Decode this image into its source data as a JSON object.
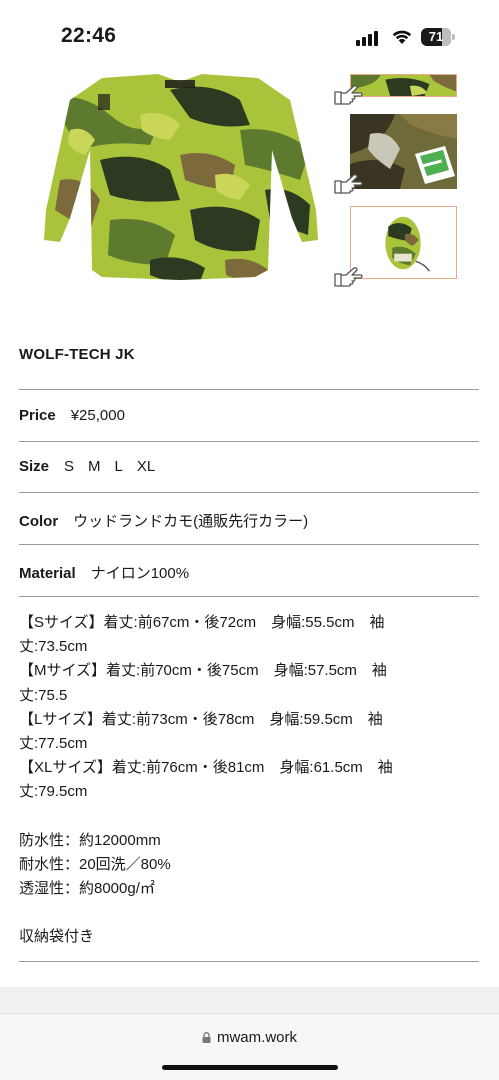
{
  "status_bar": {
    "time": "22:46",
    "battery_level": "71",
    "battery_fraction": 0.71
  },
  "gallery": {
    "main_image": "camo-jacket-photo",
    "thumbnails": [
      "camo-fabric-closeup-thumbnail",
      "camo-tag-detail-thumbnail",
      "camo-stuff-bag-thumbnail"
    ],
    "pointer_icon": "pointing-hand-icon",
    "camo_colors": [
      "#a9c43a",
      "#5d7a2e",
      "#2c3a22",
      "#7d6a3c",
      "#c9d65a"
    ],
    "thumb_border_color": "#e8a98c"
  },
  "product": {
    "name": "WOLF-TECH JK",
    "price_label": "Price",
    "price_value": "¥25,000",
    "size_label": "Size",
    "sizes": [
      "S",
      "M",
      "L",
      "XL"
    ],
    "color_label": "Color",
    "color_value": "ウッドランドカモ(通販先行カラー)",
    "material_label": "Material",
    "material_value": "ナイロン100%"
  },
  "description": {
    "size_lines": [
      "【Sサイズ】着丈:前67cm・後72cm　身幅:55.5cm　袖",
      "丈:73.5cm",
      "【Mサイズ】着丈:前70cm・後75cm　身幅:57.5cm　袖",
      "丈:75.5",
      "【Lサイズ】着丈:前73cm・後78cm　身幅:59.5cm　袖",
      "丈:77.5cm",
      "【XLサイズ】着丈:前76cm・後81cm　身幅:61.5cm　袖",
      "丈:79.5cm"
    ],
    "performance_lines": [
      "防水性：約12000mm",
      "耐水性：20回洗／80%",
      "透湿性：約8000g/㎡"
    ],
    "accessory": "収納袋付き"
  },
  "browser": {
    "url": "mwam.work",
    "lock_icon": "lock-icon"
  }
}
